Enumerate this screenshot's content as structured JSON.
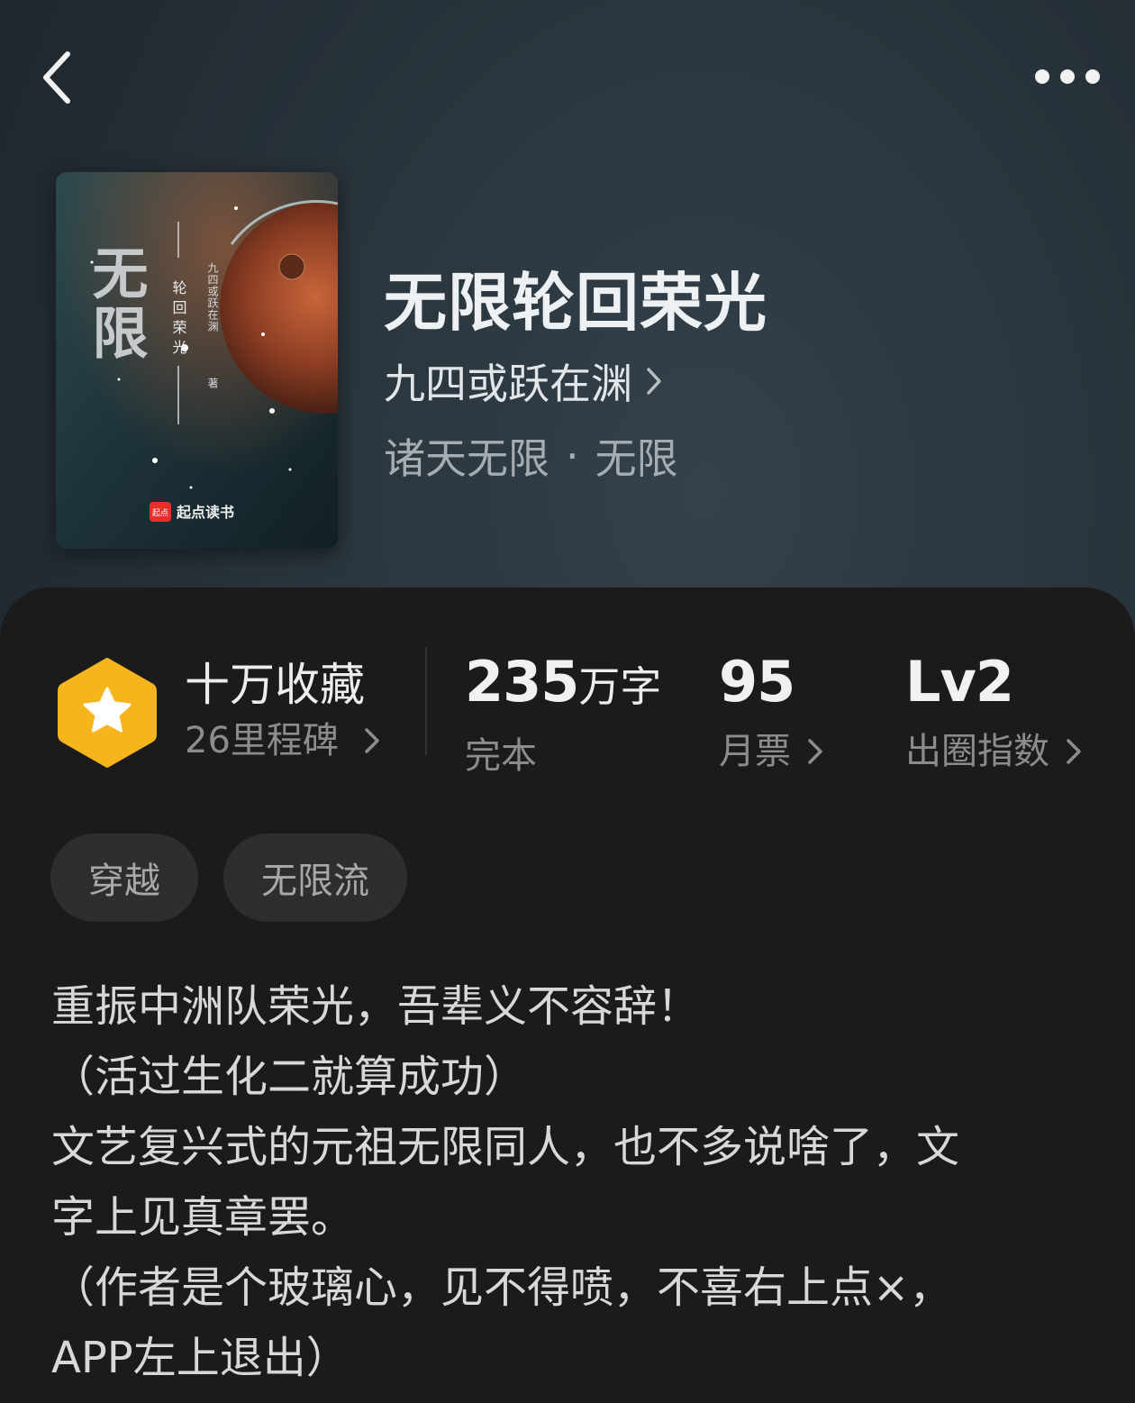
{
  "nav": {
    "back_icon": "chevron-left-icon",
    "more_icon": "more-horizontal-icon"
  },
  "cover": {
    "title_big": "无限",
    "subtitle": "轮回荣光",
    "author_vertical": "九四或跃在渊",
    "author_mark": "著",
    "publisher_logo_text": "起点",
    "publisher": "起点读书"
  },
  "book": {
    "title": "无限轮回荣光",
    "author": "九四或跃在渊",
    "genre_main": "诸天无限",
    "genre_separator": "·",
    "genre_sub": "无限"
  },
  "stats": {
    "collect_title": "十万收藏",
    "collect_sub": "26里程碑",
    "word_count_num": "235",
    "word_count_unit": "万字",
    "status": "完本",
    "monthly_votes": "95",
    "monthly_votes_label": "月票",
    "influence_level": "Lv2",
    "influence_label": "出圈指数"
  },
  "tags": [
    "穿越",
    "无限流"
  ],
  "synopsis": [
    "重振中洲队荣光，吾辈义不容辞！",
    "（活过生化二就算成功）",
    "文艺复兴式的元祖无限同人，也不多说啥了，文",
    "字上见真章罢。",
    "（作者是个玻璃心，见不得喷，不喜右上点×，",
    "APP左上退出）"
  ],
  "colors": {
    "badge_orange": "#f7b51d",
    "header_bg": "#2a353d",
    "panel_bg": "#1b1b1b",
    "tag_bg": "#2e2e2e"
  }
}
